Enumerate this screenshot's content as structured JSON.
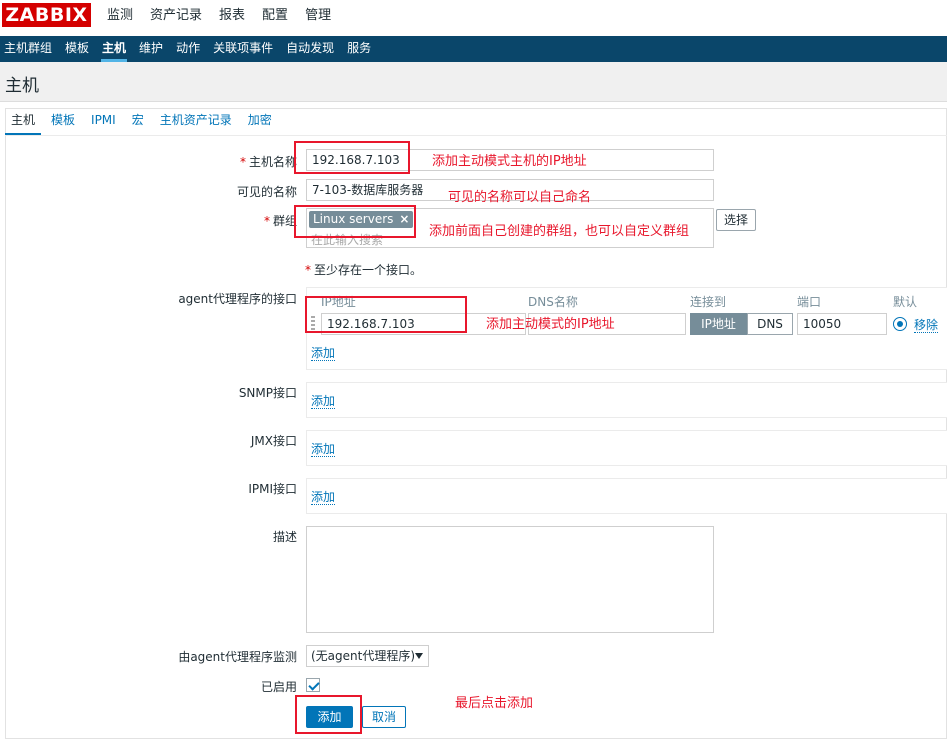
{
  "app": {
    "logo": "ZABBIX"
  },
  "top_menu": [
    {
      "label": "监测",
      "active": false
    },
    {
      "label": "资产记录",
      "active": false
    },
    {
      "label": "报表",
      "active": false
    },
    {
      "label": "配置",
      "active": true
    },
    {
      "label": "管理",
      "active": false
    }
  ],
  "sub_menu": [
    {
      "label": "主机群组",
      "active": false
    },
    {
      "label": "模板",
      "active": false
    },
    {
      "label": "主机",
      "active": true
    },
    {
      "label": "维护",
      "active": false
    },
    {
      "label": "动作",
      "active": false
    },
    {
      "label": "关联项事件",
      "active": false
    },
    {
      "label": "自动发现",
      "active": false
    },
    {
      "label": "服务",
      "active": false
    }
  ],
  "page": {
    "title": "主机"
  },
  "tabs": [
    {
      "label": "主机",
      "active": true
    },
    {
      "label": "模板",
      "active": false
    },
    {
      "label": "IPMI",
      "active": false
    },
    {
      "label": "宏",
      "active": false
    },
    {
      "label": "主机资产记录",
      "active": false
    },
    {
      "label": "加密",
      "active": false
    }
  ],
  "form": {
    "host_name": {
      "label": "主机名称",
      "value": "192.168.7.103",
      "required_mark": "*"
    },
    "visible_name": {
      "label": "可见的名称",
      "value": "7-103-数据库服务器"
    },
    "groups": {
      "label": "群组",
      "required_mark": "*",
      "tag": "Linux servers",
      "tag_remove": "×",
      "placeholder": "在此输入搜索",
      "select_button": "选择"
    },
    "interface_note": {
      "mark": "*",
      "text": "至少存在一个接口。"
    },
    "agent_interfaces": {
      "label": "agent代理程序的接口",
      "columns": {
        "ip": "IP地址",
        "dns": "DNS名称",
        "connect": "连接到",
        "port": "端口",
        "default": "默认"
      },
      "row": {
        "ip": "192.168.7.103",
        "dns": "",
        "connect_ip": "IP地址",
        "connect_dns": "DNS",
        "port": "10050",
        "remove": "移除"
      },
      "add": "添加"
    },
    "snmp": {
      "label": "SNMP接口",
      "add": "添加"
    },
    "jmx": {
      "label": "JMX接口",
      "add": "添加"
    },
    "ipmi": {
      "label": "IPMI接口",
      "add": "添加"
    },
    "description": {
      "label": "描述",
      "value": ""
    },
    "monitored_by_proxy": {
      "label": "由agent代理程序监测",
      "value": "(无agent代理程序)"
    },
    "enabled": {
      "label": "已启用",
      "checked": true
    },
    "buttons": {
      "add": "添加",
      "cancel": "取消"
    }
  },
  "annotations": {
    "host_name_note": "添加主动模式主机的IP地址",
    "visible_name_note": "可见的名称可以自己命名",
    "group_note": "添加前面自己创建的群组，也可以自定义群组",
    "ip_note": "添加主动模式的IP地址",
    "submit_note": "最后点击添加"
  },
  "colors": {
    "brand": "#d40000",
    "nav_bg": "#0a466a",
    "link": "#0275b8",
    "annotation": "#e8172c"
  }
}
